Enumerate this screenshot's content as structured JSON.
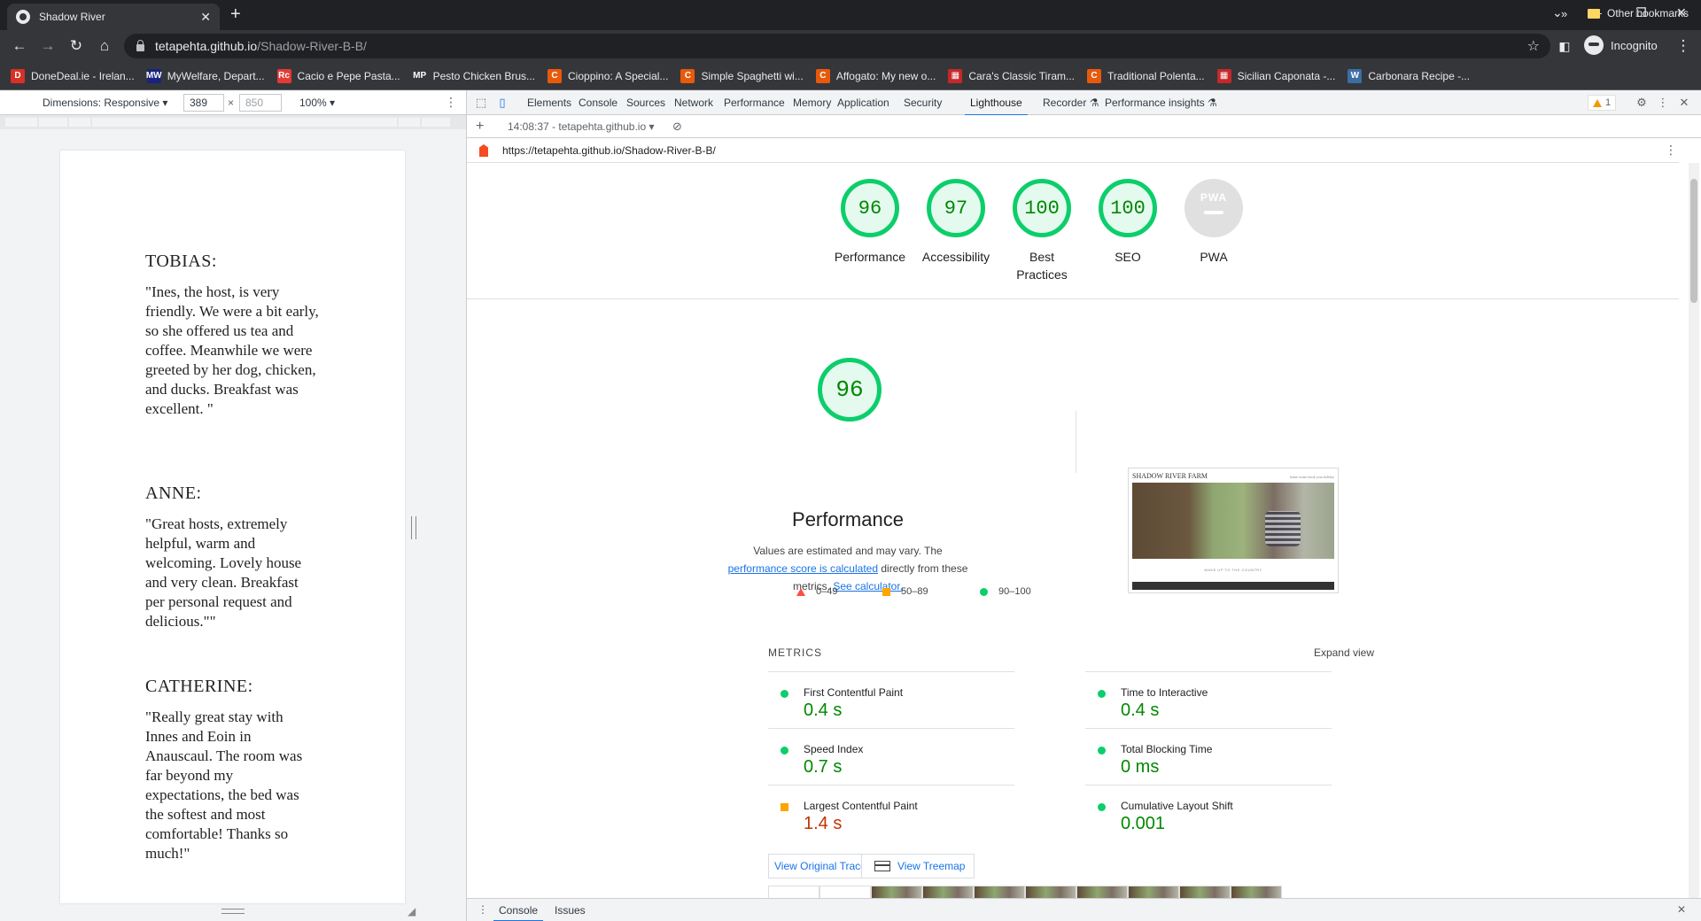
{
  "browser": {
    "tab_title": "Shadow River",
    "url_host": "tetapehta.github.io",
    "url_path": "/Shadow-River-B-B/",
    "profile_label": "Incognito"
  },
  "bookmarks": [
    {
      "label": "DoneDeal.ie - Irelan...",
      "icon": "D",
      "color": "#d93025"
    },
    {
      "label": "MyWelfare, Depart...",
      "icon": "MW",
      "color": "#1a237e"
    },
    {
      "label": "Cacio e Pepe Pasta...",
      "icon": "Rc",
      "color": "#e53935"
    },
    {
      "label": "Pesto Chicken Brus...",
      "icon": "MP",
      "color": "#35363a"
    },
    {
      "label": "Cioppino: A Special...",
      "icon": "C",
      "color": "#e8590c"
    },
    {
      "label": "Simple Spaghetti wi...",
      "icon": "C",
      "color": "#e8590c"
    },
    {
      "label": "Affogato: My new o...",
      "icon": "C",
      "color": "#e8590c"
    },
    {
      "label": "Cara's Classic Tiram...",
      "icon": "▦",
      "color": "#c62828"
    },
    {
      "label": "Traditional Polenta...",
      "icon": "C",
      "color": "#e8590c"
    },
    {
      "label": "Sicilian Caponata -...",
      "icon": "▦",
      "color": "#c62828"
    },
    {
      "label": "Carbonara Recipe -...",
      "icon": "W",
      "color": "#3b6ea5"
    }
  ],
  "bookmarks_more": "»",
  "bookmarks_other": "Other bookmarks",
  "device_toolbar": {
    "dimensions": "Dimensions: Responsive ▾",
    "width": "389",
    "height": "850",
    "times": "×",
    "zoom": "100% ▾"
  },
  "reviews": [
    {
      "name": "TOBIAS:",
      "quote": "\"Ines, the host, is very friendly. We were a bit early, so she offered us tea and coffee. Meanwhile we were greeted by her dog, chicken, and ducks. Breakfast was excellent. \""
    },
    {
      "name": "ANNE:",
      "quote": "\"Great hosts, extremely helpful, warm and welcoming. Lovely house and very clean. Breakfast per personal request and delicious.\"\""
    },
    {
      "name": "CATHERINE:",
      "quote": "\"Really great stay with Innes and Eoin in Anauscaul. The room was far beyond my expectations, the bed was the softest and most comfortable! Thanks so much!\""
    }
  ],
  "devtools": {
    "tabs": [
      "Elements",
      "Console",
      "Sources",
      "Network",
      "Performance",
      "Memory",
      "Application",
      "Security",
      "Lighthouse",
      "Recorder ⚗",
      "Performance insights ⚗"
    ],
    "active_tab": "Lighthouse",
    "warning_count": "1",
    "report_selector": "14:08:37 - tetapehta.github.io ▾",
    "report_url": "https://tetapehta.github.io/Shadow-River-B-B/",
    "drawer_tabs": [
      "Console",
      "Issues"
    ]
  },
  "scores": [
    {
      "label": "Performance",
      "value": "96"
    },
    {
      "label": "Accessibility",
      "value": "97"
    },
    {
      "label": "Best Practices",
      "value": "100"
    },
    {
      "label": "SEO",
      "value": "100"
    },
    {
      "label": "PWA",
      "value": "PWA"
    }
  ],
  "score_colors": {
    "pass": "#0cce6b",
    "average": "#ffa400",
    "fail": "#ff4e42"
  },
  "performance": {
    "score": "96",
    "title": "Performance",
    "note_prefix": "Values are estimated and may vary. The ",
    "note_link1": "performance score is calculated",
    "note_middle": " directly from these metrics. ",
    "note_link2": "See calculator.",
    "legend": [
      "0–49",
      "50–89",
      "90–100"
    ]
  },
  "screenshot": {
    "site_title": "SHADOW RIVER FARM",
    "site_sub": "home   rooms   book   your   holiday",
    "caption": "WAKE UP TO THE COUNTRY"
  },
  "metrics": {
    "header": "METRICS",
    "expand": "Expand view",
    "items": [
      {
        "label": "First Contentful Paint",
        "value": "0.4 s",
        "rating": "pass"
      },
      {
        "label": "Time to Interactive",
        "value": "0.4 s",
        "rating": "pass"
      },
      {
        "label": "Speed Index",
        "value": "0.7 s",
        "rating": "pass"
      },
      {
        "label": "Total Blocking Time",
        "value": "0 ms",
        "rating": "pass"
      },
      {
        "label": "Largest Contentful Paint",
        "value": "1.4 s",
        "rating": "average"
      },
      {
        "label": "Cumulative Layout Shift",
        "value": "0.001",
        "rating": "pass"
      }
    ]
  },
  "buttons": {
    "view_trace": "View Original Trace",
    "view_treemap": "View Treemap"
  }
}
